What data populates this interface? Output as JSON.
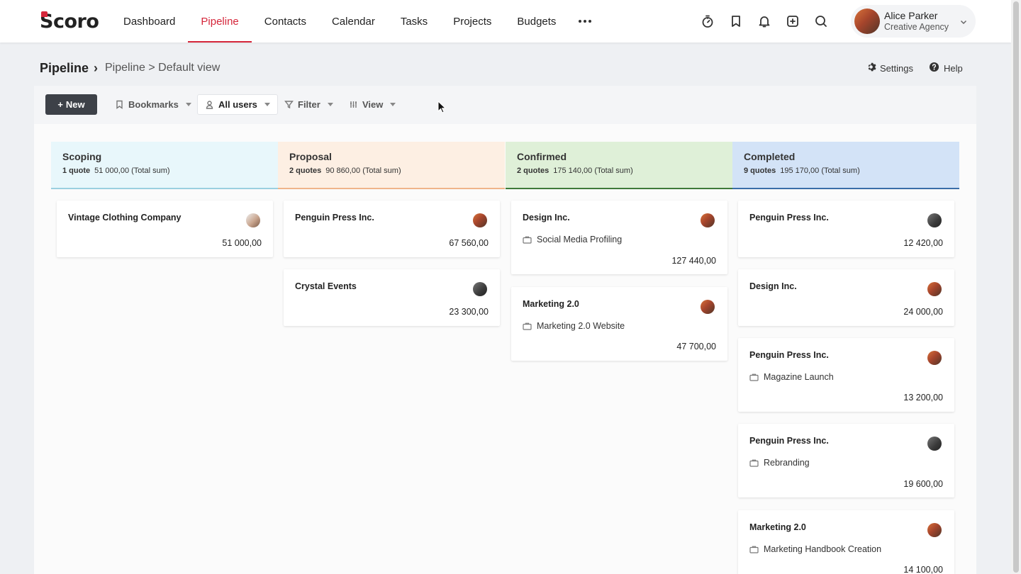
{
  "app": {
    "logo_text": "Scoro"
  },
  "nav": {
    "items": [
      {
        "label": "Dashboard"
      },
      {
        "label": "Pipeline",
        "active": true
      },
      {
        "label": "Contacts"
      },
      {
        "label": "Calendar"
      },
      {
        "label": "Tasks"
      },
      {
        "label": "Projects"
      },
      {
        "label": "Budgets"
      }
    ],
    "tool_icons": [
      "timer-icon",
      "bookmark-icon",
      "bell-icon",
      "add-square-icon",
      "search-icon"
    ]
  },
  "user": {
    "name": "Alice Parker",
    "org": "Creative Agency"
  },
  "breadcrumb": {
    "title": "Pipeline",
    "separator": "›",
    "path": "Pipeline > Default view"
  },
  "header_links": {
    "settings": "Settings",
    "help": "Help"
  },
  "toolbar": {
    "new_label": "New",
    "new_prefix": "+",
    "bookmarks_label": "Bookmarks",
    "users_label": "All users",
    "filter_label": "Filter",
    "view_label": "View"
  },
  "colors": {
    "accent": "#d5263a",
    "scoping_bg": "#e8f7fb",
    "scoping_line": "#9bd0e0",
    "proposal_bg": "#fdefe3",
    "proposal_line": "#f0b48a",
    "confirmed_bg": "#dff0d8",
    "confirmed_line": "#3f7a3a",
    "completed_bg": "#d3e3f7",
    "completed_line": "#3a6ea8"
  },
  "columns": [
    {
      "title": "Scoping",
      "count": "1 quote",
      "sum": "51 000,00 (Total sum)",
      "cards": [
        {
          "company": "Vintage Clothing Company",
          "project": "",
          "amount": "51 000,00",
          "avatar": "light"
        }
      ]
    },
    {
      "title": "Proposal",
      "count": "2 quotes",
      "sum": "90 860,00 (Total sum)",
      "cards": [
        {
          "company": "Penguin Press Inc.",
          "project": "",
          "amount": "67 560,00",
          "avatar": "warm"
        },
        {
          "company": "Crystal Events",
          "project": "",
          "amount": "23 300,00",
          "avatar": "dark"
        }
      ]
    },
    {
      "title": "Confirmed",
      "count": "2 quotes",
      "sum": "175 140,00 (Total sum)",
      "cards": [
        {
          "company": "Design Inc.",
          "project": "Social Media Profiling",
          "amount": "127 440,00",
          "avatar": "warm"
        },
        {
          "company": "Marketing 2.0",
          "project": "Marketing 2.0 Website",
          "amount": "47 700,00",
          "avatar": "warm"
        }
      ]
    },
    {
      "title": "Completed",
      "count": "9 quotes",
      "sum": "195 170,00 (Total sum)",
      "cards": [
        {
          "company": "Penguin Press Inc.",
          "project": "",
          "amount": "12 420,00",
          "avatar": "dark"
        },
        {
          "company": "Design Inc.",
          "project": "",
          "amount": "24 000,00",
          "avatar": "warm"
        },
        {
          "company": "Penguin Press Inc.",
          "project": "Magazine Launch",
          "amount": "13 200,00",
          "avatar": "warm"
        },
        {
          "company": "Penguin Press Inc.",
          "project": "Rebranding",
          "amount": "19 600,00",
          "avatar": "dark"
        },
        {
          "company": "Marketing 2.0",
          "project": "Marketing Handbook Creation",
          "amount": "14 100,00",
          "avatar": "warm"
        }
      ]
    }
  ]
}
